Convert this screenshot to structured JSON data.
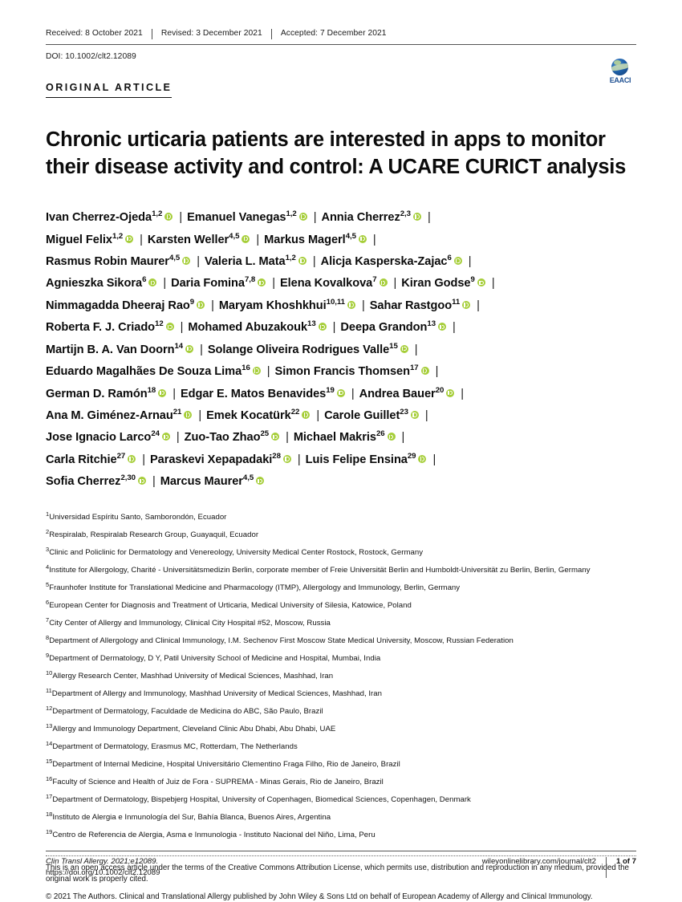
{
  "header": {
    "received": "Received: 8 October 2021",
    "revised": "Revised: 3 December 2021",
    "accepted": "Accepted: 7 December 2021",
    "doi": "DOI: 10.1002/clt2.12089",
    "article_type": "ORIGINAL ARTICLE",
    "logo_text": "EAACI",
    "logo_color": "#1d4f91"
  },
  "title": "Chronic urticaria patients are interested in apps to monitor their disease activity and control: A UCARE CURICT analysis",
  "orcid_color": "#a6ce39",
  "author_lines": [
    [
      {
        "name": "Ivan Cherrez-Ojeda",
        "sup": "1,2",
        "orcid": true
      },
      {
        "name": "Emanuel Vanegas",
        "sup": "1,2",
        "orcid": true
      },
      {
        "name": "Annia Cherrez",
        "sup": "2,3",
        "orcid": true
      }
    ],
    [
      {
        "name": "Miguel Felix",
        "sup": "1,2",
        "orcid": true
      },
      {
        "name": "Karsten Weller",
        "sup": "4,5",
        "orcid": true
      },
      {
        "name": "Markus Magerl",
        "sup": "4,5",
        "orcid": true
      }
    ],
    [
      {
        "name": "Rasmus Robin Maurer",
        "sup": "4,5",
        "orcid": true
      },
      {
        "name": "Valeria L. Mata",
        "sup": "1,2",
        "orcid": true
      },
      {
        "name": "Alicja Kasperska-Zajac",
        "sup": "6",
        "orcid": true
      }
    ],
    [
      {
        "name": "Agnieszka Sikora",
        "sup": "6",
        "orcid": true
      },
      {
        "name": "Daria Fomina",
        "sup": "7,8",
        "orcid": true
      },
      {
        "name": "Elena Kovalkova",
        "sup": "7",
        "orcid": true
      },
      {
        "name": "Kiran Godse",
        "sup": "9",
        "orcid": true
      }
    ],
    [
      {
        "name": "Nimmagadda Dheeraj Rao",
        "sup": "9",
        "orcid": true
      },
      {
        "name": "Maryam Khoshkhui",
        "sup": "10,11",
        "orcid": true
      },
      {
        "name": "Sahar Rastgoo",
        "sup": "11",
        "orcid": true
      }
    ],
    [
      {
        "name": "Roberta F. J. Criado",
        "sup": "12",
        "orcid": true
      },
      {
        "name": "Mohamed Abuzakouk",
        "sup": "13",
        "orcid": true
      },
      {
        "name": "Deepa Grandon",
        "sup": "13",
        "orcid": true
      }
    ],
    [
      {
        "name": "Martijn B. A. Van Doorn",
        "sup": "14",
        "orcid": true
      },
      {
        "name": "Solange Oliveira Rodrigues Valle",
        "sup": "15",
        "orcid": true
      }
    ],
    [
      {
        "name": "Eduardo Magalhães De Souza Lima",
        "sup": "16",
        "orcid": true
      },
      {
        "name": "Simon Francis Thomsen",
        "sup": "17",
        "orcid": true
      }
    ],
    [
      {
        "name": "German D. Ramón",
        "sup": "18",
        "orcid": true
      },
      {
        "name": "Edgar E. Matos Benavides",
        "sup": "19",
        "orcid": true
      },
      {
        "name": "Andrea Bauer",
        "sup": "20",
        "orcid": true
      }
    ],
    [
      {
        "name": "Ana M. Giménez-Arnau",
        "sup": "21",
        "orcid": true
      },
      {
        "name": "Emek Kocatürk",
        "sup": "22",
        "orcid": true
      },
      {
        "name": "Carole Guillet",
        "sup": "23",
        "orcid": true
      }
    ],
    [
      {
        "name": "Jose Ignacio Larco",
        "sup": "24",
        "orcid": true
      },
      {
        "name": "Zuo-Tao Zhao",
        "sup": "25",
        "orcid": true
      },
      {
        "name": "Michael Makris",
        "sup": "26",
        "orcid": true
      }
    ],
    [
      {
        "name": "Carla Ritchie",
        "sup": "27",
        "orcid": true
      },
      {
        "name": "Paraskevi Xepapadaki",
        "sup": "28",
        "orcid": true
      },
      {
        "name": "Luis Felipe Ensina",
        "sup": "29",
        "orcid": true
      }
    ],
    [
      {
        "name": "Sofia Cherrez",
        "sup": "2,30",
        "orcid": true
      },
      {
        "name": "Marcus Maurer",
        "sup": "4,5",
        "orcid": true
      }
    ]
  ],
  "affiliations": [
    {
      "num": "1",
      "text": "Universidad Espíritu Santo, Samborondón, Ecuador"
    },
    {
      "num": "2",
      "text": "Respiralab, Respiralab Research Group, Guayaquil, Ecuador"
    },
    {
      "num": "3",
      "text": "Clinic and Policlinic for Dermatology and Venereology, University Medical Center Rostock, Rostock, Germany"
    },
    {
      "num": "4",
      "text": "Institute for Allergology, Charité - Universitätsmedizin Berlin, corporate member of Freie Universität Berlin and Humboldt-Universität zu Berlin, Berlin, Germany"
    },
    {
      "num": "5",
      "text": "Fraunhofer Institute for Translational Medicine and Pharmacology (ITMP), Allergology and Immunology, Berlin, Germany"
    },
    {
      "num": "6",
      "text": "European Center for Diagnosis and Treatment of Urticaria, Medical University of Silesia, Katowice, Poland"
    },
    {
      "num": "7",
      "text": "City Center of Allergy and Immunology, Clinical City Hospital #52, Moscow, Russia"
    },
    {
      "num": "8",
      "text": "Department of Allergology and Clinical Immunology, I.M. Sechenov First Moscow State Medical University, Moscow, Russian Federation"
    },
    {
      "num": "9",
      "text": "Department of Dermatology, D Y, Patil University School of Medicine and Hospital, Mumbai, India"
    },
    {
      "num": "10",
      "text": "Allergy Research Center, Mashhad University of Medical Sciences, Mashhad, Iran"
    },
    {
      "num": "11",
      "text": "Department of Allergy and Immunology, Mashhad University of Medical Sciences, Mashhad, Iran"
    },
    {
      "num": "12",
      "text": "Department of Dermatology, Faculdade de Medicina do ABC, São Paulo, Brazil"
    },
    {
      "num": "13",
      "text": "Allergy and Immunology Department, Cleveland Clinic Abu Dhabi, Abu Dhabi, UAE"
    },
    {
      "num": "14",
      "text": "Department of Dermatology, Erasmus MC, Rotterdam, The Netherlands"
    },
    {
      "num": "15",
      "text": "Department of Internal Medicine, Hospital Universitário Clementino Fraga Filho, Rio de Janeiro, Brazil"
    },
    {
      "num": "16",
      "text": "Faculty of Science and Health of Juiz de Fora - SUPREMA - Minas Gerais, Rio de Janeiro, Brazil"
    },
    {
      "num": "17",
      "text": "Department of Dermatology, Bispebjerg Hospital, University of Copenhagen, Biomedical Sciences, Copenhagen, Denmark"
    },
    {
      "num": "18",
      "text": "Instituto de Alergia e Inmunología del Sur, Bahía Blanca, Buenos Aires, Argentina"
    },
    {
      "num": "19",
      "text": "Centro de Referencia de Alergia, Asma e Inmunologia - Instituto Nacional del Niño, Lima, Peru"
    }
  ],
  "license": "This is an open access article under the terms of the Creative Commons Attribution License, which permits use, distribution and reproduction in any medium, provided the original work is properly cited.",
  "copyright": "© 2021 The Authors. Clinical and Translational Allergy published by John Wiley & Sons Ltd on behalf of European Academy of Allergy and Clinical Immunology.",
  "footer": {
    "citation": "Clin Transl Allergy. 2021;e12089.",
    "doi_url": "https://doi.org/10.1002/clt2.12089",
    "journal_url": "wileyonlinelibrary.com/journal/clt2",
    "page": "1 of 7"
  }
}
